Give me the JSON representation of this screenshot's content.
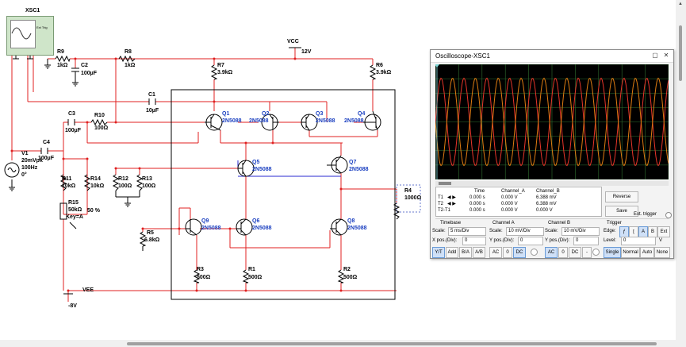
{
  "schematic": {
    "xsc1_label": "XSC1",
    "xsc1_ext_trig": "Ext Trig",
    "vcc_label": "VCC",
    "vcc_value": "12V",
    "vee_label": "VEE",
    "vee_value": "-8V",
    "v1": {
      "name": "V1",
      "amp": "20mVpk",
      "freq": "100Hz",
      "phase": "0°"
    },
    "r9": {
      "name": "R9",
      "value": "1kΩ"
    },
    "r8": {
      "name": "R8",
      "value": "1kΩ"
    },
    "c2": {
      "name": "C2",
      "value": "100µF"
    },
    "r7": {
      "name": "R7",
      "value": "3.9kΩ"
    },
    "r6": {
      "name": "R6",
      "value": "3.9kΩ"
    },
    "c1": {
      "name": "C1",
      "value": "10µF"
    },
    "c3": {
      "name": "C3",
      "value": "100µF"
    },
    "r10": {
      "name": "R10",
      "value": "100Ω"
    },
    "c4": {
      "name": "C4",
      "value": "100µF"
    },
    "r11": {
      "name": "R11",
      "value": "10kΩ"
    },
    "r14": {
      "name": "R14",
      "value": "10kΩ"
    },
    "r12": {
      "name": "R12",
      "value": "100Ω"
    },
    "r13": {
      "name": "R13",
      "value": "100Ω"
    },
    "r15": {
      "name": "R15",
      "value": "50kΩ",
      "key": "Key=A",
      "percent": "50 %"
    },
    "r5": {
      "name": "R5",
      "value": "6.8kΩ"
    },
    "r4": {
      "name": "R4",
      "value": "1000Ω"
    },
    "r3": {
      "name": "R3",
      "value": "500Ω"
    },
    "r1": {
      "name": "R1",
      "value": "500Ω"
    },
    "r2": {
      "name": "R2",
      "value": "500Ω"
    },
    "q1": {
      "name": "Q1",
      "part": "2N5088"
    },
    "q2": {
      "name": "Q2",
      "part": "2N5088"
    },
    "q3": {
      "name": "Q3",
      "part": "2N5088"
    },
    "q4": {
      "name": "Q4",
      "part": "2N5088"
    },
    "q5": {
      "name": "Q5",
      "part": "2N5088"
    },
    "q6": {
      "name": "Q6",
      "part": "2N5088"
    },
    "q7": {
      "name": "Q7",
      "part": "2N5088"
    },
    "q8": {
      "name": "Q8",
      "part": "2N5088"
    },
    "q9": {
      "name": "Q9",
      "part": "2N5088"
    }
  },
  "oscilloscope": {
    "title": "Oscilloscope-XSC1",
    "colors": {
      "channel_a": "#e8352a",
      "channel_b": "#e07c12",
      "grid": "#2f6f2f",
      "screen": "#000000"
    },
    "readout": {
      "headers": [
        "",
        "Time",
        "Channel_A",
        "Channel_B"
      ],
      "rows": [
        {
          "label": "T1",
          "time": "0.000 s",
          "a": "0.000 V",
          "b": "6.388 mV"
        },
        {
          "label": "T2",
          "time": "0.000 s",
          "a": "0.000 V",
          "b": "6.388 mV"
        },
        {
          "label": "T2-T1",
          "time": "0.000 s",
          "a": "0.000 V",
          "b": "0.000 V"
        }
      ]
    },
    "reverse_label": "Reverse",
    "save_label": "Save",
    "ext_trigger_label": "Ext. trigger",
    "timebase": {
      "title": "Timebase",
      "scale_label": "Scale:",
      "scale": "5 ms/Div",
      "xpos_label": "X pos.(Div):",
      "xpos": "0",
      "buttons": [
        "Y/T",
        "Add",
        "B/A",
        "A/B"
      ]
    },
    "channel_a": {
      "title": "Channel A",
      "scale_label": "Scale:",
      "scale": "10 mV/Div",
      "ypos_label": "Y pos.(Div):",
      "ypos": "0",
      "buttons": [
        "AC",
        "0",
        "DC"
      ]
    },
    "channel_b": {
      "title": "Channel B",
      "scale_label": "Scale:",
      "scale": "10 mV/Div",
      "ypos_label": "Y pos.(Div):",
      "ypos": "0",
      "buttons": [
        "AC",
        "0",
        "DC",
        "-"
      ]
    },
    "trigger": {
      "title": "Trigger",
      "edge_label": "Edge:",
      "edge_buttons": [
        "A",
        "B",
        "Ext"
      ],
      "level_label": "Level:",
      "level": "0",
      "level_unit": "V",
      "mode_buttons": [
        "Single",
        "Normal",
        "Auto",
        "None"
      ]
    }
  }
}
